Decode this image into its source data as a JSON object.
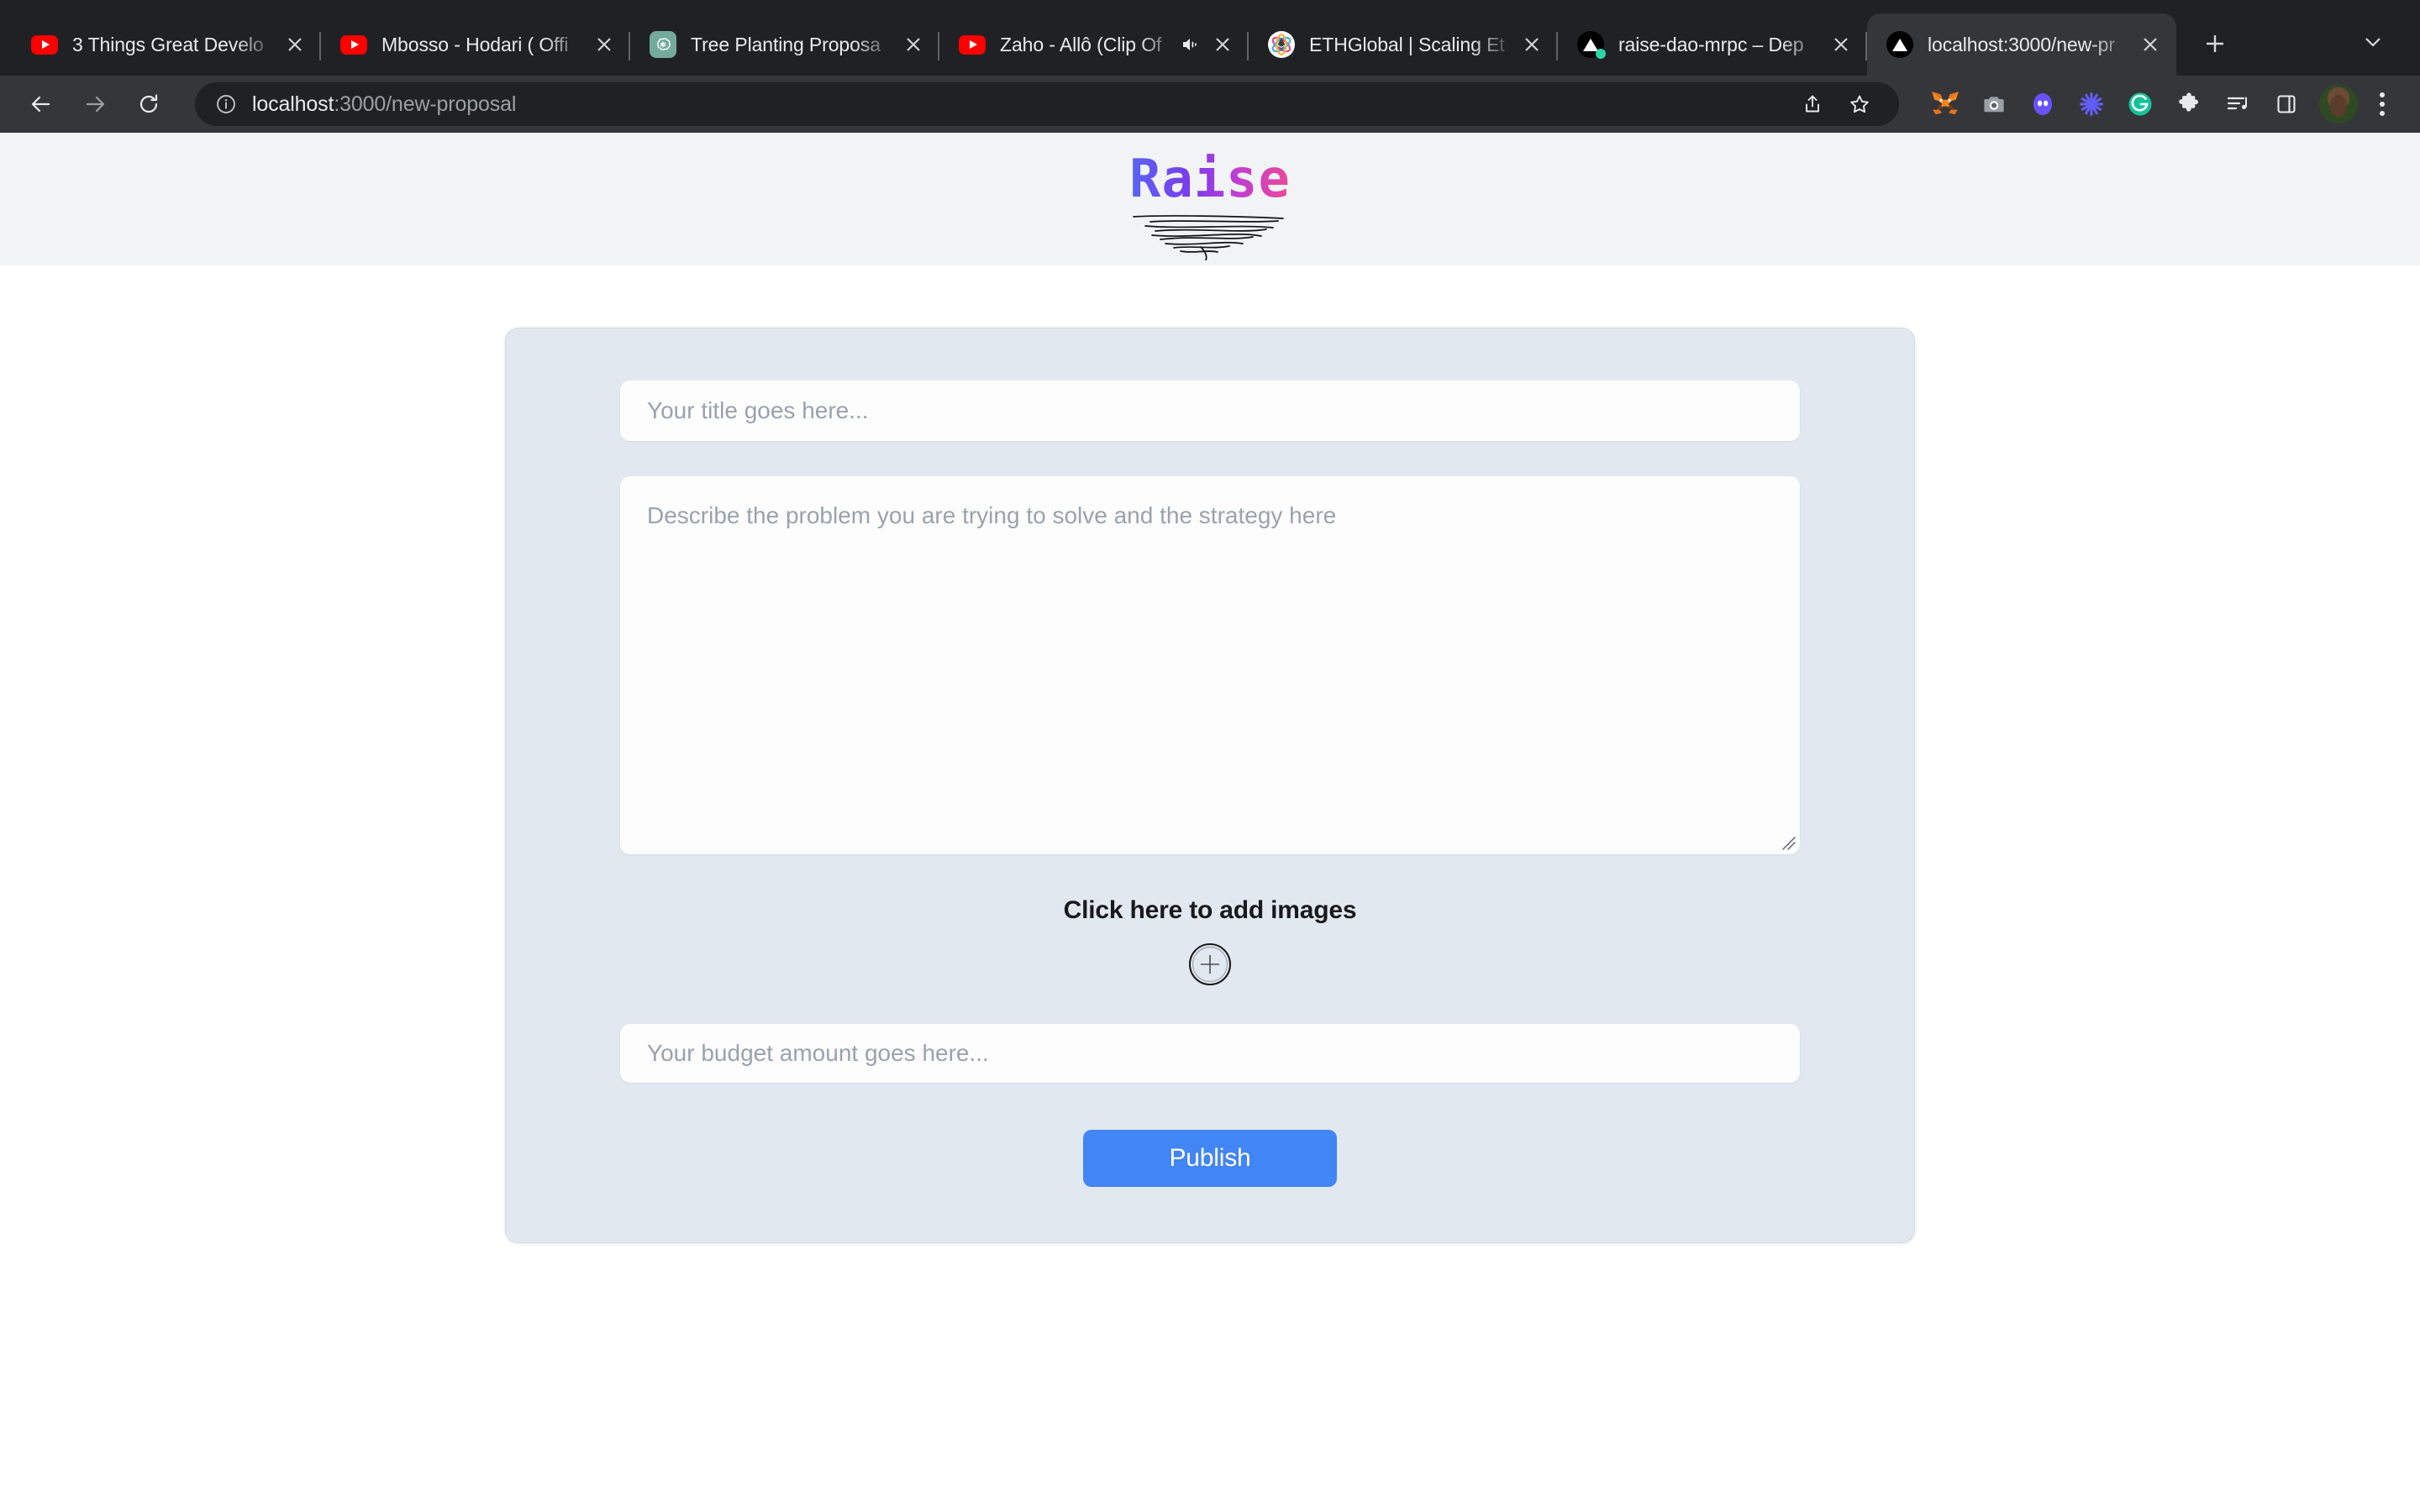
{
  "browser": {
    "tabs": [
      {
        "title": "3 Things Great Develo",
        "favicon": "youtube-icon",
        "active": false,
        "audio": false
      },
      {
        "title": "Mbosso - Hodari ( Offi",
        "favicon": "youtube-icon",
        "active": false,
        "audio": false
      },
      {
        "title": "Tree Planting Proposa",
        "favicon": "chatgpt-icon",
        "active": false,
        "audio": false
      },
      {
        "title": "Zaho - Allô (Clip Of",
        "favicon": "youtube-icon",
        "active": false,
        "audio": true
      },
      {
        "title": "ETHGlobal | Scaling Et",
        "favicon": "ethglobal-icon",
        "active": false,
        "audio": false
      },
      {
        "title": "raise-dao-mrpc – Dep",
        "favicon": "vercel-icon",
        "active": false,
        "audio": false
      },
      {
        "title": "localhost:3000/new-pr",
        "favicon": "vercel-icon",
        "active": true,
        "audio": false
      }
    ],
    "new_tab_label": "+",
    "tab_search_label": "v",
    "close_label": "✕",
    "toolbar": {
      "back_label": "←",
      "forward_label": "→",
      "reload_label": "⟳",
      "url_scheme": "localhost",
      "url_rest": ":3000/new-proposal",
      "url_full": "localhost:3000/new-proposal",
      "info_label": "i",
      "share_label": "share-icon",
      "bookmark_label": "star-icon"
    },
    "extensions": [
      {
        "name": "metamask-icon",
        "color": "#e2761b"
      },
      {
        "name": "screenshot-camera-icon",
        "color": "#9aa0a6"
      },
      {
        "name": "phantom-wallet-icon",
        "color": "#6851ff"
      },
      {
        "name": "loom-icon",
        "color": "#625df5"
      },
      {
        "name": "grammarly-icon",
        "color": "#15c39a"
      },
      {
        "name": "extensions-puzzle-icon",
        "color": "#e8eaed"
      },
      {
        "name": "media-playlist-icon",
        "color": "#e8eaed"
      },
      {
        "name": "side-panel-icon",
        "color": "#e8eaed"
      }
    ]
  },
  "site": {
    "logo_text": "Raise",
    "logo_gradient_from": "#5865f2",
    "logo_gradient_to": "#ec4899",
    "header_bg": "#f1f3f4"
  },
  "form": {
    "title_placeholder": "Your title goes here...",
    "title_value": "",
    "description_placeholder": "Describe the problem you are trying to solve and the strategy here",
    "description_value": "",
    "image_upload_label": "Click here to add images",
    "add_image_icon": "plus-circle-icon",
    "budget_placeholder": "Your budget amount goes here...",
    "budget_value": "",
    "publish_label": "Publish",
    "publish_color": "#4285f4",
    "card_bg": "#e2e8f0"
  }
}
